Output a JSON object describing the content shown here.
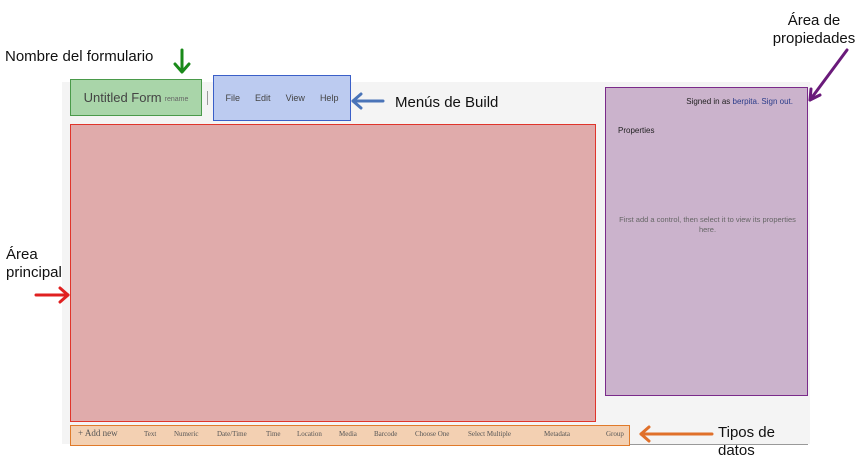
{
  "colors": {
    "form_name_fill": "#a9d5a9",
    "menus_fill": "#bccbf0",
    "main_fill": "#e0abab",
    "properties_fill": "#cbb3cc",
    "types_fill": "#f3d0b2",
    "green_arrow": "#1a8a1a",
    "blue_arrow": "#4a74b8",
    "red_arrow": "#e02020",
    "purple_arrow": "#6a1a7a",
    "orange_arrow": "#e0702a"
  },
  "annotations": {
    "form_name": "Nombre del formulario",
    "build_menus": "Menús de Build",
    "main_area_line1": "Área",
    "main_area_line2": "principal",
    "properties_area_line1": "Área de",
    "properties_area_line2": "propiedades",
    "data_types_line1": "Tipos de",
    "data_types_line2": "datos"
  },
  "header": {
    "form_title": "Untitled Form",
    "rename_label": "rename",
    "menus": [
      "File",
      "Edit",
      "View",
      "Help"
    ]
  },
  "properties_panel": {
    "signed_in_prefix": "Signed in as",
    "username": "berpita.",
    "sign_out": "Sign out.",
    "title": "Properties",
    "hint": "First add a control, then select it to view its properties here."
  },
  "toolbar": {
    "add_new": "+ Add new",
    "types": [
      "Text",
      "Numeric",
      "Date/Time",
      "Time",
      "Location",
      "Media",
      "Barcode",
      "Choose One",
      "Select Multiple",
      "Metadata",
      "Group"
    ]
  }
}
